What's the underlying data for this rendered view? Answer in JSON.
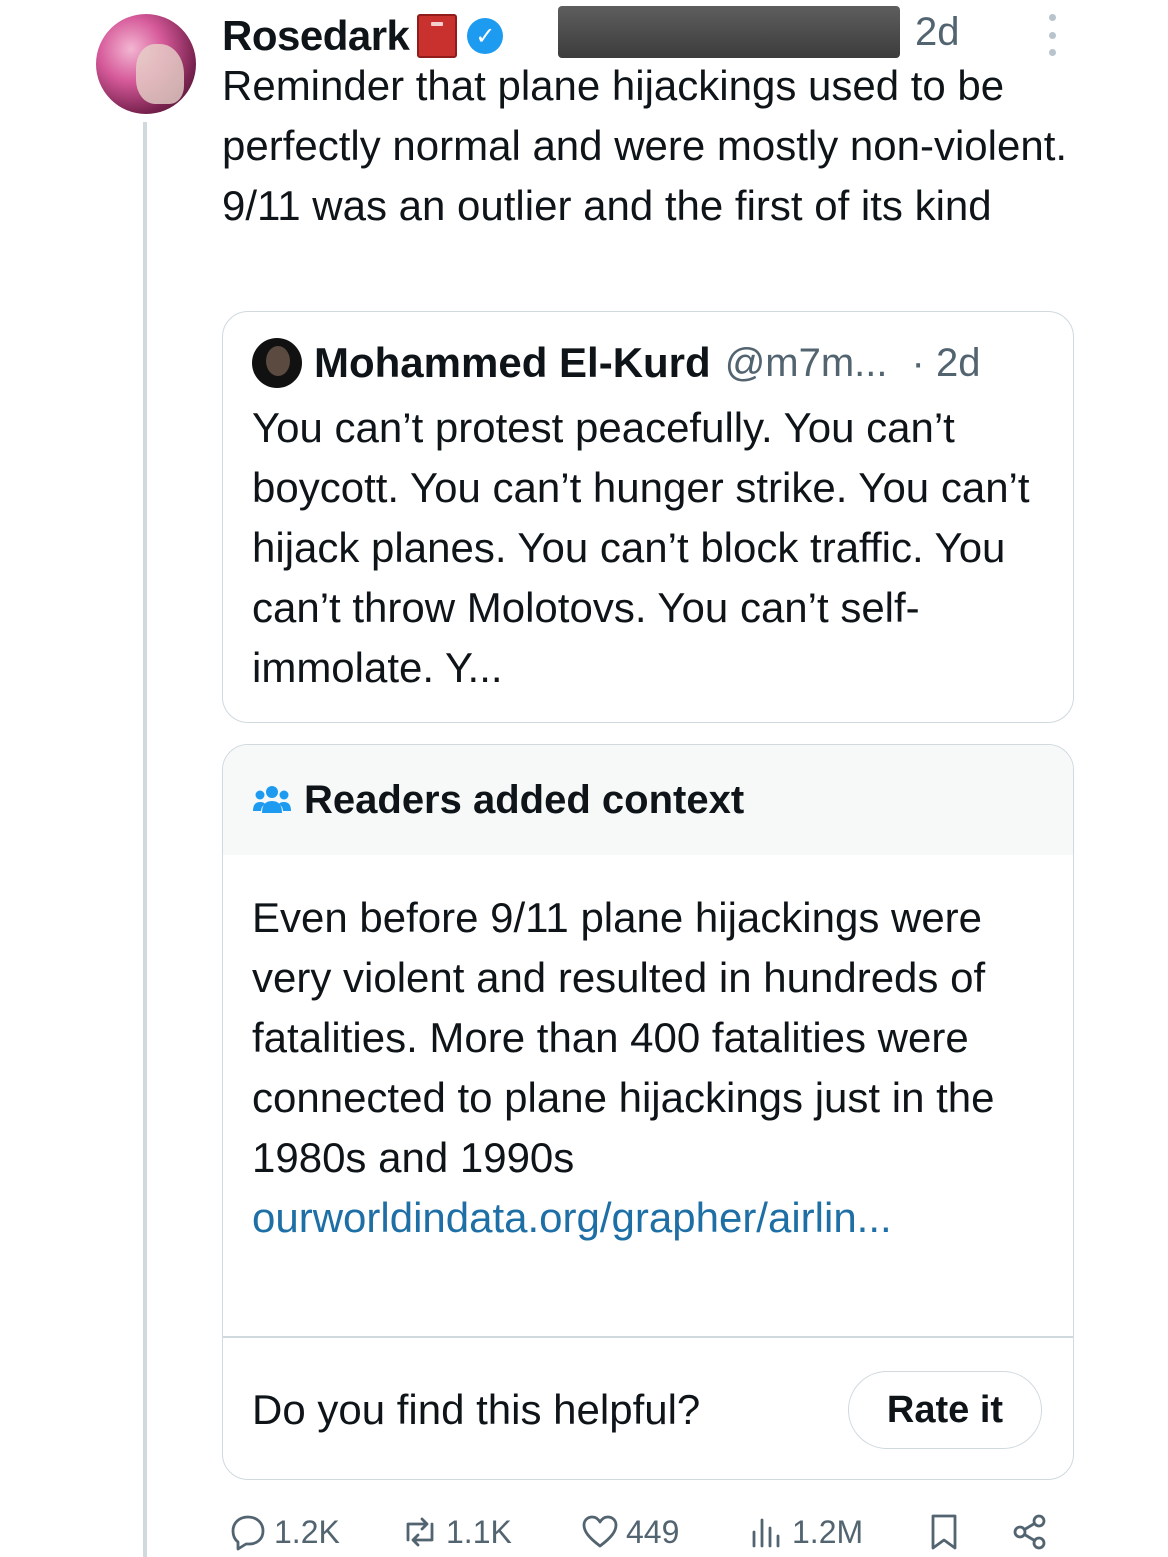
{
  "tweet": {
    "author_name": "Rosedark",
    "author_emoji": "book-icon",
    "verified": "✓",
    "time": "2d",
    "text": "Reminder that plane hijackings used to be perfectly normal and were mostly non-violent. 9/11 was an outlier and the first of its kind"
  },
  "quoted": {
    "author_name": "Mohammed El-Kurd",
    "handle": "@m7m...",
    "time": "· 2d",
    "text": "You can’t protest peacefully. You can’t boycott. You can’t hunger strike. You can’t hijack planes. You can’t block traffic. You can’t throw Molotovs. You can’t self-immolate. Y..."
  },
  "note": {
    "title": "Readers added context",
    "text": "Even before 9/11 plane hijackings were very violent and resulted in hundreds of fatalities. More than 400 fatalities were connected to plane hijackings just in the 1980s and 1990s ",
    "link": "ourworldindata.org/grapher/airlin...",
    "helpful_question": "Do you find this helpful?",
    "rate_label": "Rate it"
  },
  "actions": {
    "replies": "1.2K",
    "reposts": "1.1K",
    "likes": "449",
    "views": "1.2M"
  },
  "colors": {
    "link": "#1d6fa5",
    "muted": "#536471",
    "border": "#cfd9de",
    "verified": "#1d9bf0",
    "note_icon": "#1d9bf0"
  }
}
